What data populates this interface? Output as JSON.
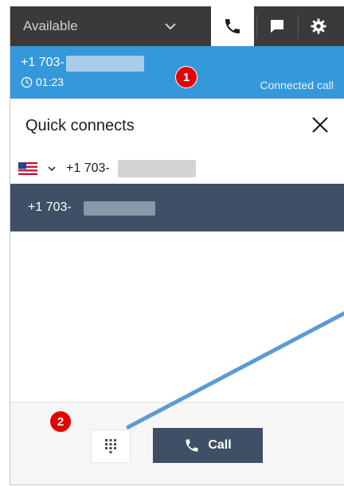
{
  "status": {
    "label": "Available"
  },
  "tabs": [
    {
      "icon": "phone-icon",
      "active": true
    },
    {
      "icon": "chat-icon",
      "active": false
    },
    {
      "icon": "gear-icon",
      "active": false
    }
  ],
  "active_call": {
    "number": "+1 703-",
    "timer": "01:23",
    "state": "Connected call"
  },
  "annotations": {
    "badge1": "1",
    "badge2": "2"
  },
  "quick_connects": {
    "title": "Quick connects",
    "country_flag": "us-flag-icon",
    "number_prefix": "+1 703-",
    "selected_item": "+1 703-"
  },
  "footer": {
    "call_label": "Call"
  },
  "colors": {
    "topbar": "#3a3a3a",
    "call_banner": "#3598db",
    "selected_row": "#3f4f66",
    "badge": "#e60000",
    "pointer": "#5b9bd5"
  }
}
